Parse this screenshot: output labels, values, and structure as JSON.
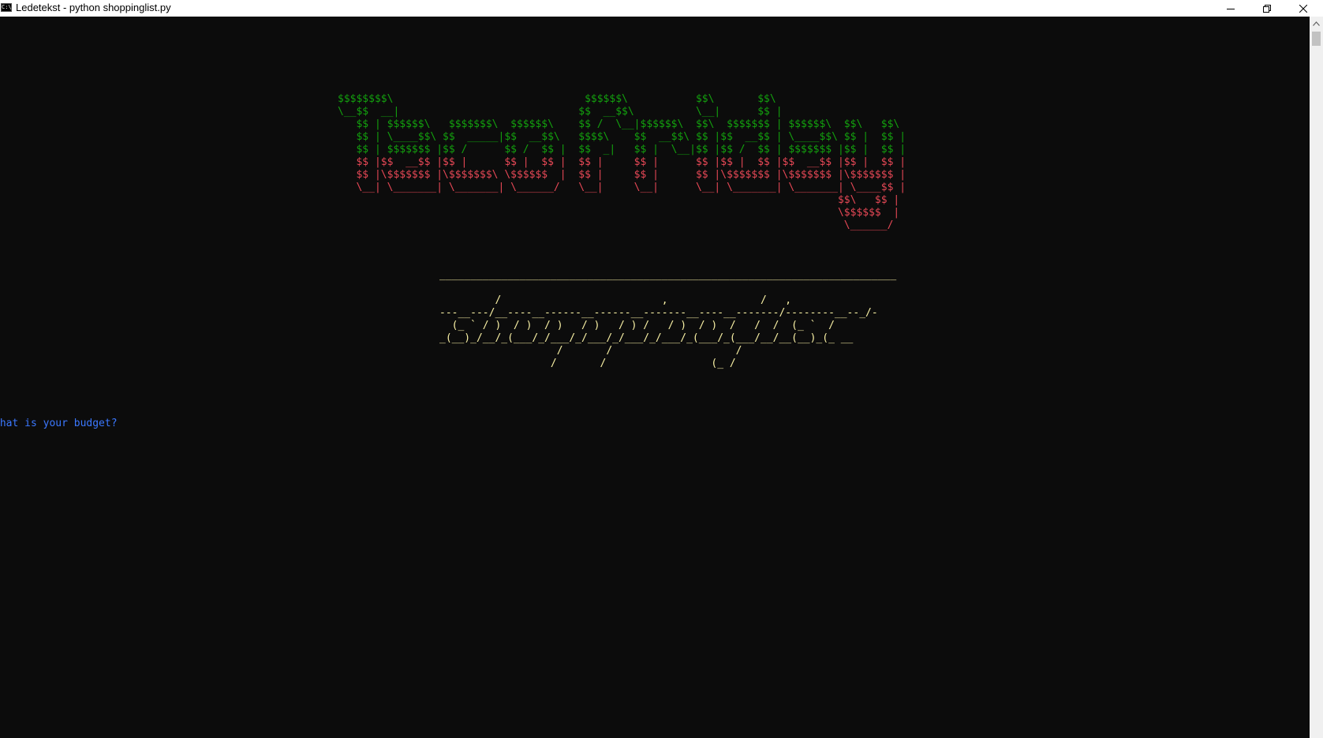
{
  "window": {
    "title": "Ledetekst - python  shoppinglist.py",
    "icon": "cmd-icon",
    "icon_text": "C:\\"
  },
  "art": {
    "title_upper": "$$$$$$$$\\                               $$$$$$\\           $$\\       $$\\\n\\__$$  __|                             $$  __$$\\          \\__|      $$ |\n   $$ | $$$$$$\\   $$$$$$$\\  $$$$$$\\    $$ /  \\__|$$$$$$\\  $$\\  $$$$$$$ | $$$$$$\\  $$\\   $$\\\n   $$ | \\____$$\\ $$  _____|$$  __$$\\   $$$$\\    $$  __$$\\ $$ |$$  __$$ | \\____$$\\ $$ |  $$ |\n   $$ | $$$$$$$ |$$ /      $$ /  $$ |  $$  _|   $$ |  \\__|$$ |$$ /  $$ | $$$$$$$ |$$ |  $$ |",
    "title_lower": "   $$ |$$  __$$ |$$ |      $$ |  $$ |  $$ |     $$ |      $$ |$$ |  $$ |$$  __$$ |$$ |  $$ |\n   $$ |\\$$$$$$$ |\\$$$$$$$\\ \\$$$$$$  |  $$ |     $$ |      $$ |\\$$$$$$$ |\\$$$$$$$ |\\$$$$$$$ |\n   \\__| \\_______| \\_______| \\______/   \\__|     \\__|      \\__| \\_______| \\_______| \\____$$ |\n                                                                                 $$\\   $$ |\n                                                                                 \\$$$$$$  |\n                                                                                  \\______/",
    "shopping": "__________________________________________________________________________\n\n         /                          ,               /   ,\n---__---/__----__------__------__-------__----__-------/--------__--_/-\n  (_ ` / )  / )  / )   / )   / ) /   / )  / )  /   /  /  (_ `  /\n_(__)_/__/_(___/_/___/_/___/_/___/_/___/_(___/_(___/__/__(__)_(_ __\n                   /       /                    /\n                  /       /                 (_ /"
  },
  "prompt": {
    "text": "What is your budget?"
  },
  "colors": {
    "background": "#0c0c0c",
    "green": "#13a10e",
    "red": "#e74856",
    "yellow": "#f9f1a5",
    "prompt_blue": "#3b78ff"
  }
}
